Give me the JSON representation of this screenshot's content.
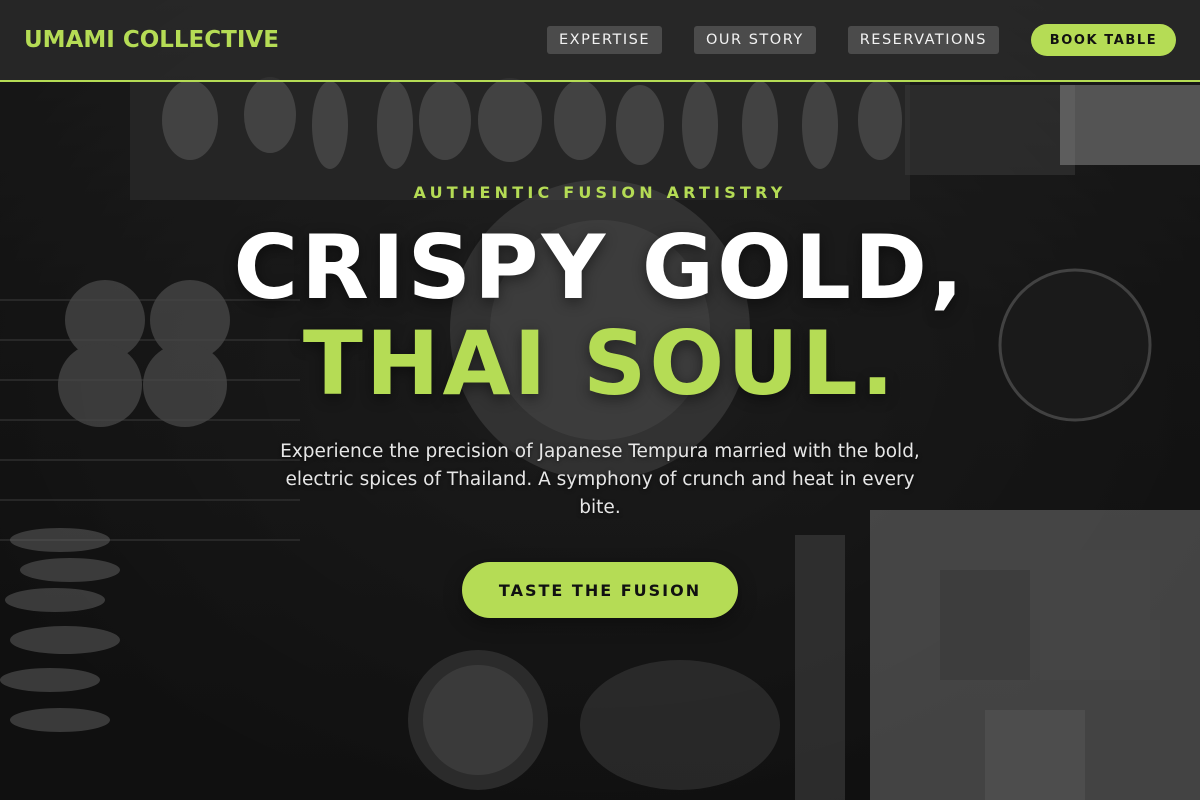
{
  "nav": {
    "brand": "UMAMI COLLECTIVE",
    "links": [
      {
        "label": "EXPERTISE"
      },
      {
        "label": "OUR STORY"
      },
      {
        "label": "RESERVATIONS"
      }
    ],
    "book_label": "BOOK TABLE"
  },
  "hero": {
    "kicker": "AUTHENTIC FUSION ARTISTRY",
    "headline_line1": "CRISPY GOLD,",
    "headline_line2": "THAI SOUL.",
    "subtext": "Experience the precision of Japanese Tempura married with the bold, electric spices of Thailand. A symphony of crunch and heat in every bite.",
    "cta_label": "TASTE THE FUSION"
  },
  "colors": {
    "accent": "#b5dc55",
    "nav_bg": "#2d2d2d",
    "text_light": "#ffffff"
  }
}
